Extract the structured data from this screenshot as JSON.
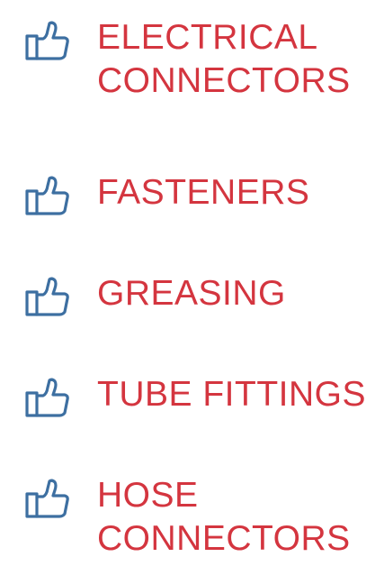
{
  "colors": {
    "text": "#d4353f",
    "icon": "#3d6fa1"
  },
  "items": [
    {
      "icon": "thumbs-up-icon",
      "lines": [
        "ELECTRICAL",
        "CONNECTORS"
      ]
    },
    {
      "icon": "thumbs-up-icon",
      "lines": [
        "FASTENERS"
      ]
    },
    {
      "icon": "thumbs-up-icon",
      "lines": [
        "GREASING"
      ]
    },
    {
      "icon": "thumbs-up-icon",
      "lines": [
        "TUBE FITTINGS"
      ]
    },
    {
      "icon": "thumbs-up-icon",
      "lines": [
        "HOSE",
        "CONNECTORS"
      ]
    }
  ]
}
